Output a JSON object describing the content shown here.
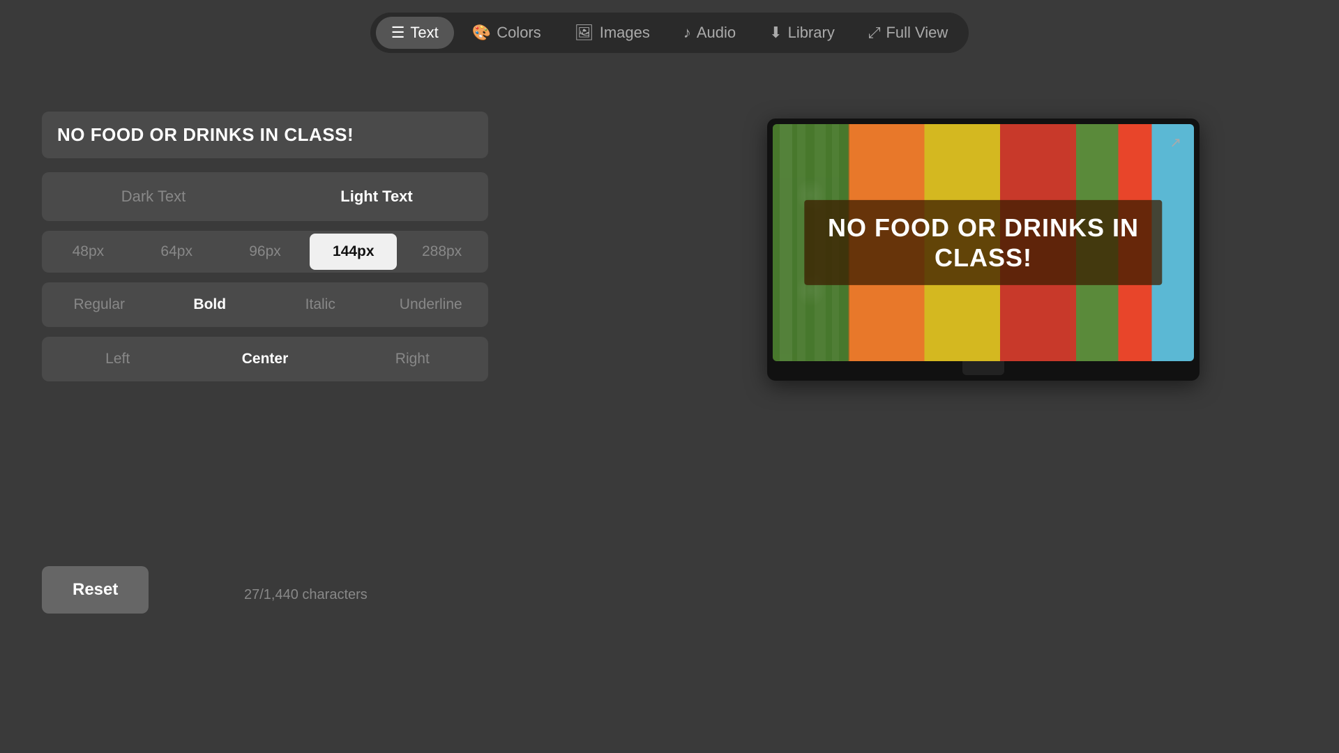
{
  "nav": {
    "items": [
      {
        "id": "text",
        "label": "Text",
        "icon": "📄",
        "active": true
      },
      {
        "id": "colors",
        "label": "Colors",
        "icon": "🎨",
        "active": false
      },
      {
        "id": "images",
        "label": "Images",
        "icon": "🖼",
        "active": false
      },
      {
        "id": "audio",
        "label": "Audio",
        "icon": "🎵",
        "active": false
      },
      {
        "id": "library",
        "label": "Library",
        "icon": "⬇",
        "active": false
      },
      {
        "id": "fullview",
        "label": "Full View",
        "icon": "⤢",
        "active": false
      }
    ]
  },
  "text_editor": {
    "content": "NO FOOD OR DRINKS IN CLASS!",
    "text_color_options": [
      {
        "id": "dark",
        "label": "Dark Text",
        "active": false
      },
      {
        "id": "light",
        "label": "Light Text",
        "active": true
      }
    ],
    "size_options": [
      {
        "id": "48",
        "label": "48px",
        "active": false
      },
      {
        "id": "64",
        "label": "64px",
        "active": false
      },
      {
        "id": "96",
        "label": "96px",
        "active": false
      },
      {
        "id": "144",
        "label": "144px",
        "active": true
      },
      {
        "id": "288",
        "label": "288px",
        "active": false
      }
    ],
    "style_options": [
      {
        "id": "regular",
        "label": "Regular",
        "active": false
      },
      {
        "id": "bold",
        "label": "Bold",
        "active": true
      },
      {
        "id": "italic",
        "label": "Italic",
        "active": false
      },
      {
        "id": "underline",
        "label": "Underline",
        "active": false
      }
    ],
    "align_options": [
      {
        "id": "left",
        "label": "Left",
        "active": false
      },
      {
        "id": "center",
        "label": "Center",
        "active": true
      },
      {
        "id": "right",
        "label": "Right",
        "active": false
      }
    ],
    "char_count": "27/1,440 characters",
    "reset_label": "Reset"
  },
  "preview": {
    "text": "NO FOOD OR DRINKS IN CLASS!"
  }
}
